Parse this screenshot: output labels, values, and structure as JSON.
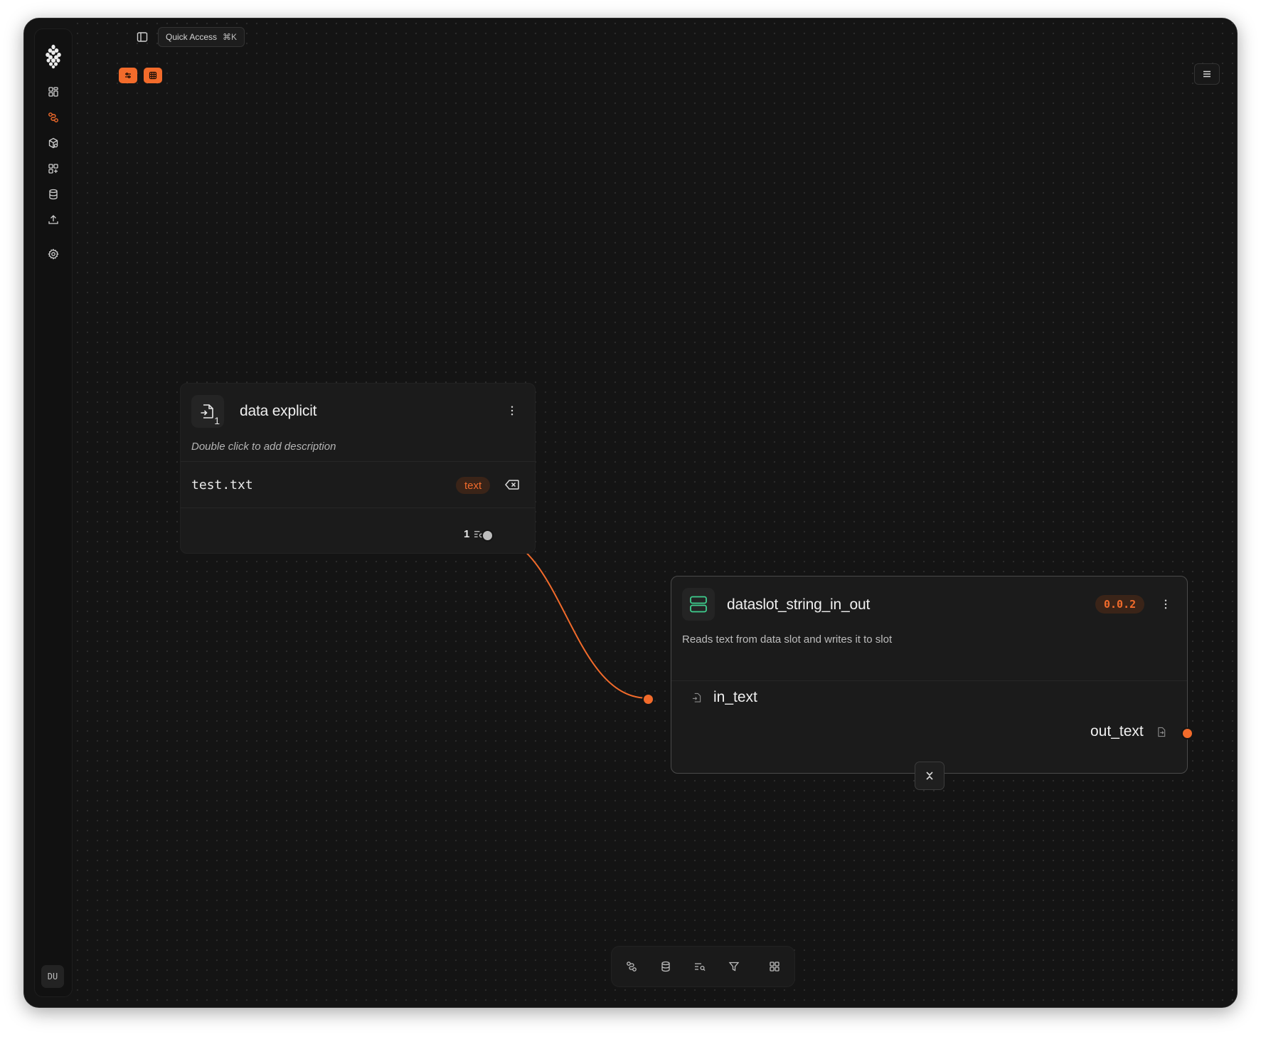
{
  "app": {
    "user_initials": "DU",
    "accent_color": "#f26b2b"
  },
  "sidebar": {
    "items": [
      {
        "icon": "dashboard-icon",
        "active": false
      },
      {
        "icon": "workflow-icon",
        "active": true
      },
      {
        "icon": "package-icon",
        "active": false
      },
      {
        "icon": "apps-icon",
        "active": false
      },
      {
        "icon": "database-icon",
        "active": false
      },
      {
        "icon": "upload-icon",
        "active": false
      },
      {
        "icon": "settings-icon",
        "active": false
      }
    ]
  },
  "topbar": {
    "quick_access_label": "Quick Access",
    "quick_access_shortcut": "⌘K"
  },
  "nodes": {
    "data_node": {
      "title": "data explicit",
      "icon_badge": "1",
      "description": "Double click to add description",
      "file": {
        "name": "test.txt",
        "type": "text"
      },
      "output_count": "1"
    },
    "process_node": {
      "title": "dataslot_string_in_out",
      "version": "0.0.2",
      "description": "Reads text from data slot and writes it to slot",
      "input_port": "in_text",
      "output_port": "out_text"
    }
  },
  "bottom_toolbar": {
    "items": [
      "workflow-icon",
      "database-icon",
      "list-search-icon",
      "filter-icon",
      "grid-icon"
    ]
  }
}
